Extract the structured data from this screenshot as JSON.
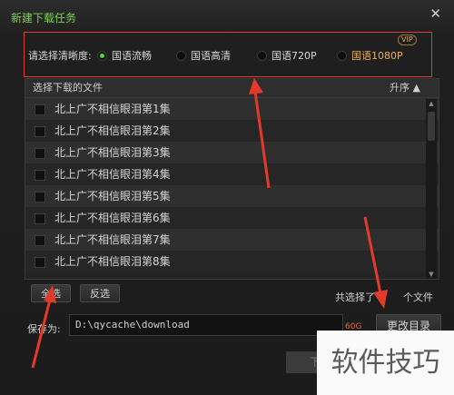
{
  "dialog": {
    "title": "新建下载任务",
    "close_glyph": "✕"
  },
  "quality": {
    "label": "请选择清晰度:",
    "options": [
      {
        "label": "国语流畅",
        "selected": true
      },
      {
        "label": "国语高清",
        "selected": false
      },
      {
        "label": "国语720P",
        "selected": false
      },
      {
        "label": "国语1080P",
        "selected": false,
        "vip": "VIP"
      }
    ]
  },
  "list": {
    "header": "选择下载的文件",
    "sort_label": "升序",
    "items": [
      "北上广不相信眼泪第1集",
      "北上广不相信眼泪第2集",
      "北上广不相信眼泪第3集",
      "北上广不相信眼泪第4集",
      "北上广不相信眼泪第5集",
      "北上广不相信眼泪第6集",
      "北上广不相信眼泪第7集",
      "北上广不相信眼泪第8集"
    ]
  },
  "actions": {
    "select_all": "全选",
    "invert": "反选",
    "selected_prefix": "共选择了",
    "selected_suffix": "个文件"
  },
  "save": {
    "label": "保存为:",
    "path": "D:\\qycache\\download",
    "size": "60G",
    "change_dir": "更改目录"
  },
  "download_button": "下",
  "watermark": "软件技巧",
  "colors": {
    "accent": "#7bd44a",
    "highlight": "#e23b3b",
    "vip": "#e8b05e"
  }
}
